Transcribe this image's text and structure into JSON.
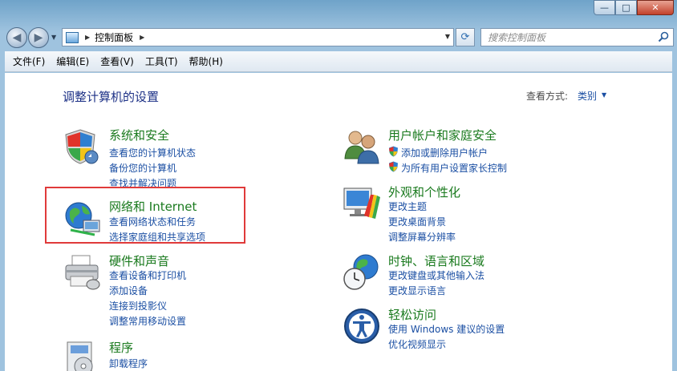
{
  "window": {
    "minimize_glyph": "—",
    "maximize_glyph": "□",
    "close_glyph": "✕"
  },
  "nav": {
    "back_glyph": "◀",
    "forward_glyph": "▶",
    "breadcrumb": "控制面板",
    "search_placeholder": "搜索控制面板"
  },
  "menu": [
    {
      "label": "文件(F)"
    },
    {
      "label": "编辑(E)"
    },
    {
      "label": "查看(V)"
    },
    {
      "label": "工具(T)"
    },
    {
      "label": "帮助(H)"
    }
  ],
  "content": {
    "heading": "调整计算机的设置",
    "view_by_label": "查看方式:",
    "view_by_value": "类别"
  },
  "categories_left": [
    {
      "title": "系统和安全",
      "icon": "shield-icon",
      "links": [
        "查看您的计算机状态",
        "备份您的计算机",
        "查找并解决问题"
      ]
    },
    {
      "title": "网络和 Internet",
      "icon": "globe-network-icon",
      "links": [
        "查看网络状态和任务",
        "选择家庭组和共享选项"
      ]
    },
    {
      "title": "硬件和声音",
      "icon": "printer-icon",
      "links": [
        "查看设备和打印机",
        "添加设备",
        "连接到投影仪",
        "调整常用移动设置"
      ]
    },
    {
      "title": "程序",
      "icon": "programs-icon",
      "links": [
        "卸载程序"
      ]
    }
  ],
  "categories_right": [
    {
      "title": "用户帐户和家庭安全",
      "icon": "users-icon",
      "links": [
        "添加或删除用户帐户",
        "为所有用户设置家长控制"
      ]
    },
    {
      "title": "外观和个性化",
      "icon": "monitor-palette-icon",
      "links": [
        "更改主题",
        "更改桌面背景",
        "调整屏幕分辨率"
      ]
    },
    {
      "title": "时钟、语言和区域",
      "icon": "clock-globe-icon",
      "links": [
        "更改键盘或其他输入法",
        "更改显示语言"
      ]
    },
    {
      "title": "轻松访问",
      "icon": "ease-of-access-icon",
      "links": [
        "使用 Windows 建议的设置",
        "优化视频显示"
      ]
    }
  ],
  "colors": {
    "title_green": "#1a7a1e",
    "link_blue": "#1b4fa3",
    "heading_blue": "#1e3287",
    "highlight_red": "#e03a3a"
  }
}
